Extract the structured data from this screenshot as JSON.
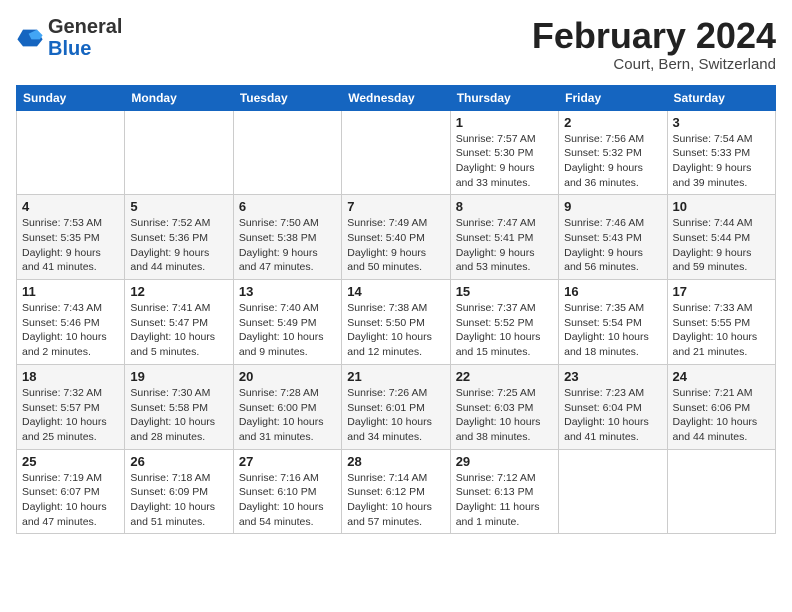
{
  "header": {
    "logo_general": "General",
    "logo_blue": "Blue",
    "month_title": "February 2024",
    "location": "Court, Bern, Switzerland"
  },
  "weekdays": [
    "Sunday",
    "Monday",
    "Tuesday",
    "Wednesday",
    "Thursday",
    "Friday",
    "Saturday"
  ],
  "weeks": [
    [
      {
        "day": "",
        "info": ""
      },
      {
        "day": "",
        "info": ""
      },
      {
        "day": "",
        "info": ""
      },
      {
        "day": "",
        "info": ""
      },
      {
        "day": "1",
        "info": "Sunrise: 7:57 AM\nSunset: 5:30 PM\nDaylight: 9 hours\nand 33 minutes."
      },
      {
        "day": "2",
        "info": "Sunrise: 7:56 AM\nSunset: 5:32 PM\nDaylight: 9 hours\nand 36 minutes."
      },
      {
        "day": "3",
        "info": "Sunrise: 7:54 AM\nSunset: 5:33 PM\nDaylight: 9 hours\nand 39 minutes."
      }
    ],
    [
      {
        "day": "4",
        "info": "Sunrise: 7:53 AM\nSunset: 5:35 PM\nDaylight: 9 hours\nand 41 minutes."
      },
      {
        "day": "5",
        "info": "Sunrise: 7:52 AM\nSunset: 5:36 PM\nDaylight: 9 hours\nand 44 minutes."
      },
      {
        "day": "6",
        "info": "Sunrise: 7:50 AM\nSunset: 5:38 PM\nDaylight: 9 hours\nand 47 minutes."
      },
      {
        "day": "7",
        "info": "Sunrise: 7:49 AM\nSunset: 5:40 PM\nDaylight: 9 hours\nand 50 minutes."
      },
      {
        "day": "8",
        "info": "Sunrise: 7:47 AM\nSunset: 5:41 PM\nDaylight: 9 hours\nand 53 minutes."
      },
      {
        "day": "9",
        "info": "Sunrise: 7:46 AM\nSunset: 5:43 PM\nDaylight: 9 hours\nand 56 minutes."
      },
      {
        "day": "10",
        "info": "Sunrise: 7:44 AM\nSunset: 5:44 PM\nDaylight: 9 hours\nand 59 minutes."
      }
    ],
    [
      {
        "day": "11",
        "info": "Sunrise: 7:43 AM\nSunset: 5:46 PM\nDaylight: 10 hours\nand 2 minutes."
      },
      {
        "day": "12",
        "info": "Sunrise: 7:41 AM\nSunset: 5:47 PM\nDaylight: 10 hours\nand 5 minutes."
      },
      {
        "day": "13",
        "info": "Sunrise: 7:40 AM\nSunset: 5:49 PM\nDaylight: 10 hours\nand 9 minutes."
      },
      {
        "day": "14",
        "info": "Sunrise: 7:38 AM\nSunset: 5:50 PM\nDaylight: 10 hours\nand 12 minutes."
      },
      {
        "day": "15",
        "info": "Sunrise: 7:37 AM\nSunset: 5:52 PM\nDaylight: 10 hours\nand 15 minutes."
      },
      {
        "day": "16",
        "info": "Sunrise: 7:35 AM\nSunset: 5:54 PM\nDaylight: 10 hours\nand 18 minutes."
      },
      {
        "day": "17",
        "info": "Sunrise: 7:33 AM\nSunset: 5:55 PM\nDaylight: 10 hours\nand 21 minutes."
      }
    ],
    [
      {
        "day": "18",
        "info": "Sunrise: 7:32 AM\nSunset: 5:57 PM\nDaylight: 10 hours\nand 25 minutes."
      },
      {
        "day": "19",
        "info": "Sunrise: 7:30 AM\nSunset: 5:58 PM\nDaylight: 10 hours\nand 28 minutes."
      },
      {
        "day": "20",
        "info": "Sunrise: 7:28 AM\nSunset: 6:00 PM\nDaylight: 10 hours\nand 31 minutes."
      },
      {
        "day": "21",
        "info": "Sunrise: 7:26 AM\nSunset: 6:01 PM\nDaylight: 10 hours\nand 34 minutes."
      },
      {
        "day": "22",
        "info": "Sunrise: 7:25 AM\nSunset: 6:03 PM\nDaylight: 10 hours\nand 38 minutes."
      },
      {
        "day": "23",
        "info": "Sunrise: 7:23 AM\nSunset: 6:04 PM\nDaylight: 10 hours\nand 41 minutes."
      },
      {
        "day": "24",
        "info": "Sunrise: 7:21 AM\nSunset: 6:06 PM\nDaylight: 10 hours\nand 44 minutes."
      }
    ],
    [
      {
        "day": "25",
        "info": "Sunrise: 7:19 AM\nSunset: 6:07 PM\nDaylight: 10 hours\nand 47 minutes."
      },
      {
        "day": "26",
        "info": "Sunrise: 7:18 AM\nSunset: 6:09 PM\nDaylight: 10 hours\nand 51 minutes."
      },
      {
        "day": "27",
        "info": "Sunrise: 7:16 AM\nSunset: 6:10 PM\nDaylight: 10 hours\nand 54 minutes."
      },
      {
        "day": "28",
        "info": "Sunrise: 7:14 AM\nSunset: 6:12 PM\nDaylight: 10 hours\nand 57 minutes."
      },
      {
        "day": "29",
        "info": "Sunrise: 7:12 AM\nSunset: 6:13 PM\nDaylight: 11 hours\nand 1 minute."
      },
      {
        "day": "",
        "info": ""
      },
      {
        "day": "",
        "info": ""
      }
    ]
  ]
}
